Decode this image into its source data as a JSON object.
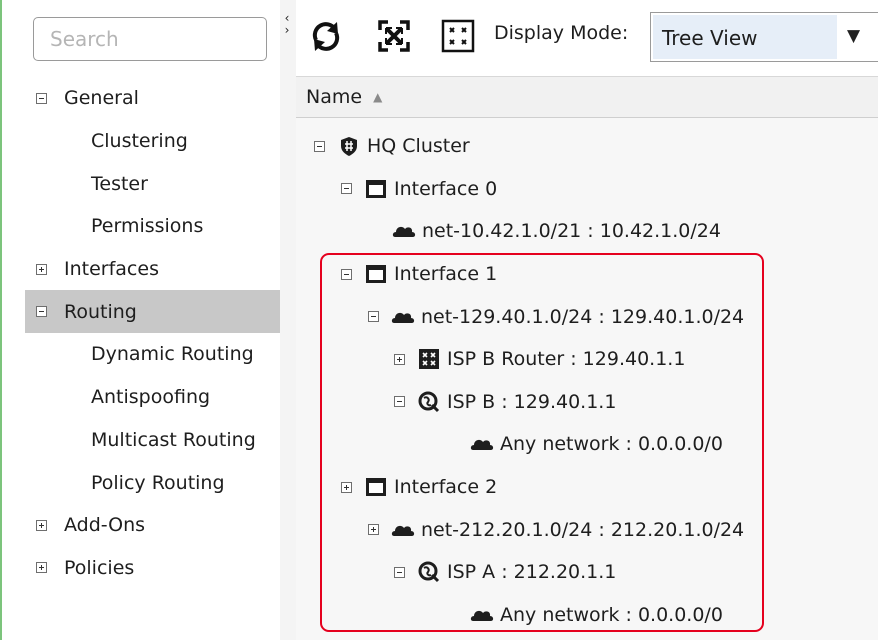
{
  "sidebar": {
    "search_placeholder": "Search",
    "items": [
      {
        "label": "General",
        "toggle": "collapse",
        "level": 0
      },
      {
        "label": "Clustering",
        "level": 1
      },
      {
        "label": "Tester",
        "level": 1
      },
      {
        "label": "Permissions",
        "level": 1
      },
      {
        "label": "Interfaces",
        "toggle": "expand",
        "level": 0
      },
      {
        "label": "Routing",
        "toggle": "collapse",
        "level": 0,
        "selected": true
      },
      {
        "label": "Dynamic Routing",
        "level": 1
      },
      {
        "label": "Antispoofing",
        "level": 1
      },
      {
        "label": "Multicast Routing",
        "level": 1
      },
      {
        "label": "Policy Routing",
        "level": 1
      },
      {
        "label": "Add-Ons",
        "toggle": "expand",
        "level": 0
      },
      {
        "label": "Policies",
        "toggle": "expand",
        "level": 0
      }
    ]
  },
  "toolbar": {
    "collapse_arrows": "‹ ›",
    "refresh_icon": "refresh-icon",
    "fit_icon": "fit-to-view-icon",
    "layout_icon": "grid-layout-icon",
    "display_mode_label": "Display Mode:",
    "display_mode_value": "Tree View"
  },
  "tree": {
    "column_header": "Name",
    "sort_indicator": "▲",
    "rows": [
      {
        "label": "HQ Cluster",
        "icon": "cluster-icon",
        "toggle": "collapse",
        "indent": 0
      },
      {
        "label": "Interface 0",
        "icon": "interface-icon",
        "toggle": "collapse",
        "indent": 1
      },
      {
        "label": "net-10.42.1.0/21 : 10.42.1.0/24",
        "icon": "network-cloud-icon",
        "indent": 2
      },
      {
        "label": "Interface 1",
        "icon": "interface-icon",
        "toggle": "collapse",
        "indent": 1
      },
      {
        "label": "net-129.40.1.0/24 : 129.40.1.0/24",
        "icon": "network-cloud-icon",
        "toggle": "collapse",
        "indent": 2
      },
      {
        "label": "ISP B Router : 129.40.1.1",
        "icon": "router-icon",
        "toggle": "expand",
        "indent": 3
      },
      {
        "label": "ISP B : 129.40.1.1",
        "icon": "isp-globe-icon",
        "toggle": "collapse",
        "indent": 3
      },
      {
        "label": "Any network : 0.0.0.0/0",
        "icon": "network-cloud-icon",
        "indent": 4
      },
      {
        "label": "Interface 2",
        "icon": "interface-icon",
        "toggle": "expand",
        "indent": 1
      },
      {
        "label": "net-212.20.1.0/24 : 212.20.1.0/24",
        "icon": "network-cloud-icon",
        "toggle": "expand",
        "indent": 2
      },
      {
        "label": "ISP A : 212.20.1.1",
        "icon": "isp-globe-icon",
        "toggle": "collapse",
        "indent": 3
      },
      {
        "label": "Any network : 0.0.0.0/0",
        "icon": "network-cloud-icon",
        "indent": 4
      }
    ]
  },
  "colors": {
    "highlight": "#e5001e",
    "selected_row": "#c8c8c8",
    "dropdown_fill": "#e6eef8"
  }
}
